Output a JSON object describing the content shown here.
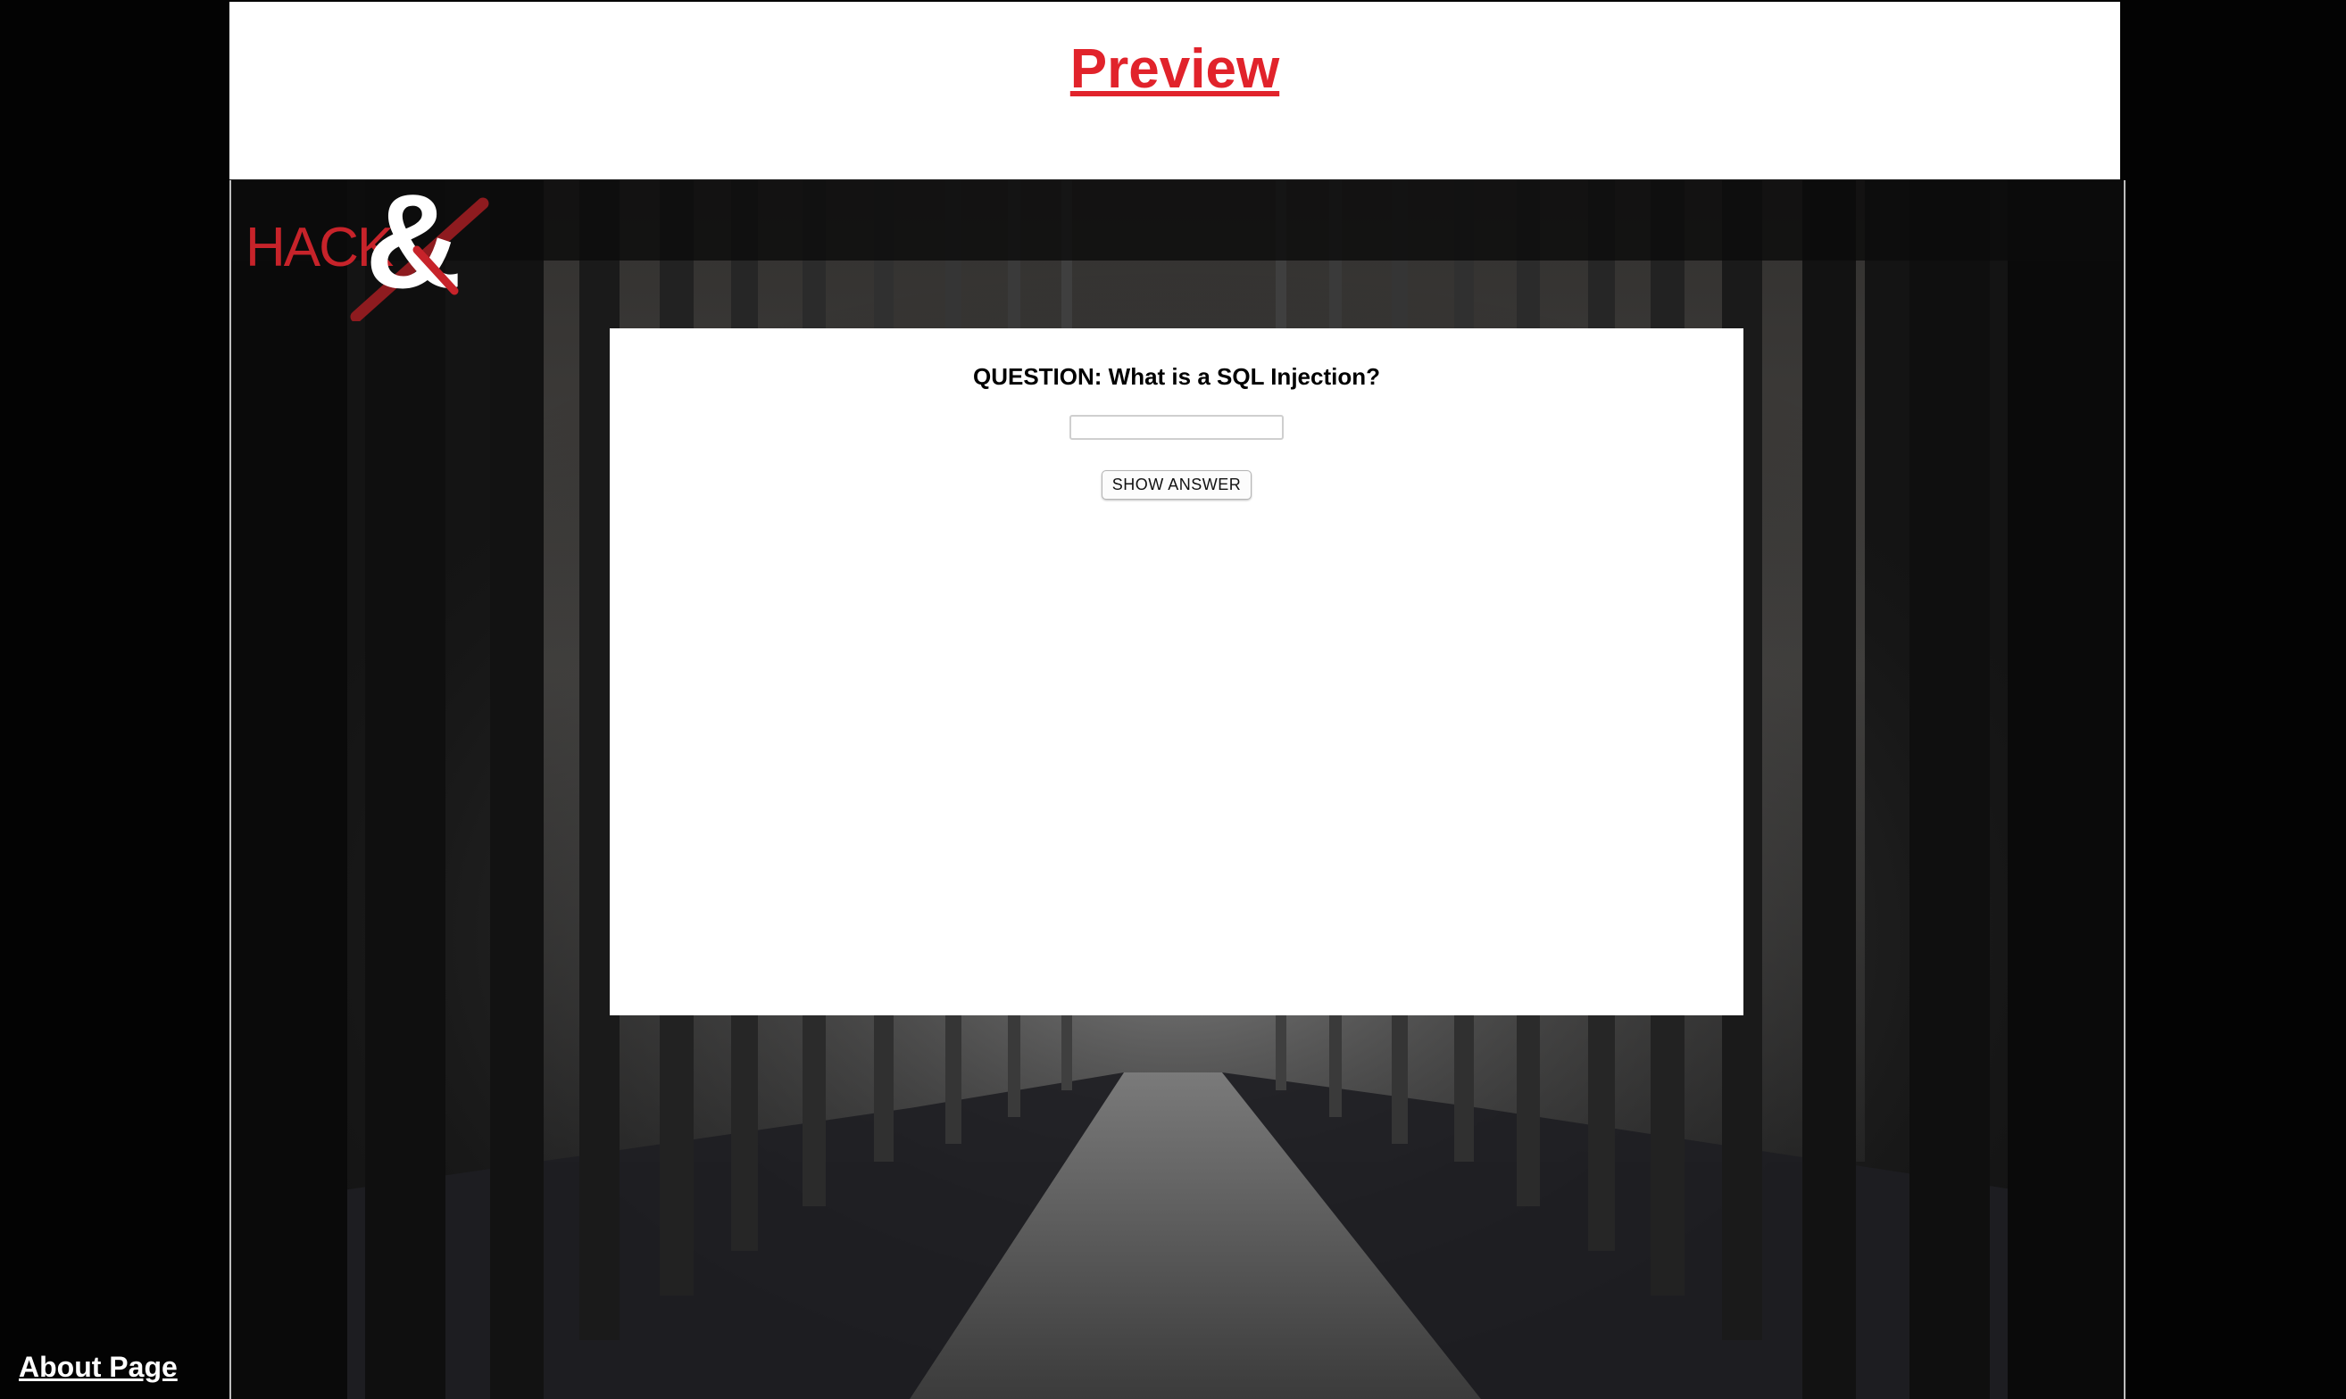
{
  "header": {
    "title": "Preview"
  },
  "logo": {
    "text": "HACK",
    "symbol": "&"
  },
  "quiz": {
    "question": "QUESTION: What is a SQL Injection?",
    "answer_value": "",
    "show_answer_label": "SHOW ANSWER"
  },
  "footer": {
    "about_label": "About Page"
  },
  "colors": {
    "accent_red": "#e1232b",
    "background": "#030303",
    "card": "#ffffff"
  }
}
